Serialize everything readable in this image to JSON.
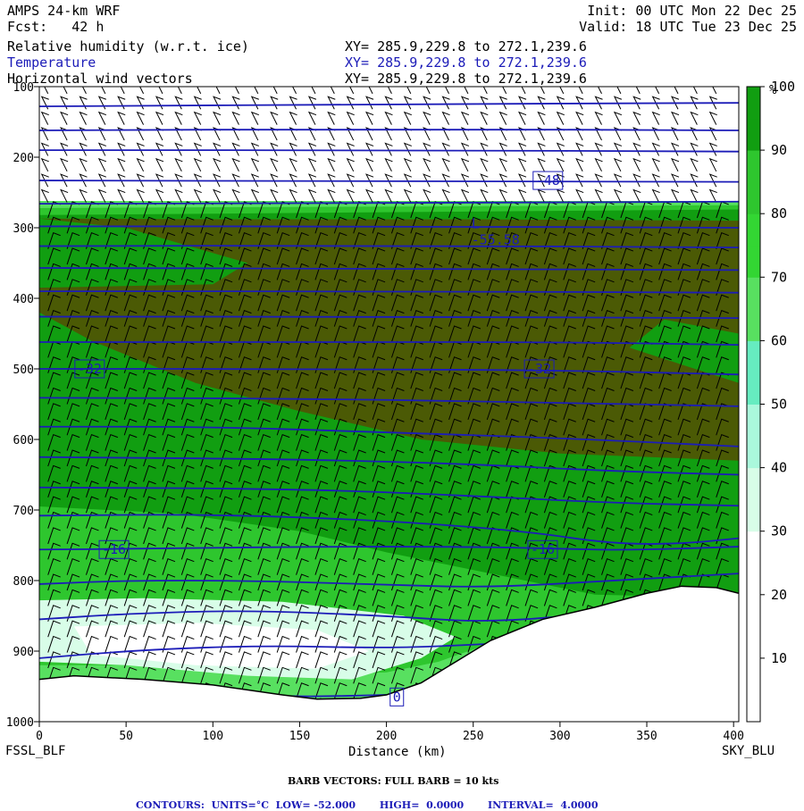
{
  "header": {
    "model": "AMPS 24-km WRF",
    "init": "Init: 00 UTC Mon 22 Dec 25",
    "fcst_label": "Fcst:",
    "fcst_value": "42 h",
    "valid": "Valid: 18 UTC Tue 23 Dec 25",
    "fields": [
      {
        "name": "Relative humidity (w.r.t. ice)",
        "xy": "XY= 285.9,229.8 to 272.1,239.6"
      },
      {
        "name": "Temperature",
        "xy": "XY= 285.9,229.8 to 272.1,239.6"
      },
      {
        "name": "Horizontal wind vectors",
        "xy": "XY= 285.9,229.8 to 272.1,239.6"
      }
    ]
  },
  "colors": {
    "contour": "#1c1cb8",
    "rh_bands": [
      "#ffffff",
      "#ffffff",
      "#ffffff",
      "#d8fde8",
      "#aaf8dc",
      "#66ecc0",
      "#58e060",
      "#33d633",
      "#2ec62e",
      "#119e11",
      "#4b5a05"
    ]
  },
  "chart_data": {
    "type": "cross-section",
    "xlabel": "Distance (km)",
    "x_ticks": [
      0,
      50,
      100,
      150,
      200,
      250,
      300,
      350,
      400
    ],
    "xlim": [
      0,
      403
    ],
    "y_ticks": [
      100,
      200,
      300,
      400,
      500,
      600,
      700,
      800,
      900,
      1000
    ],
    "ylim": [
      100,
      1000
    ],
    "left_endpoint": "FSSL_BLF",
    "right_endpoint": "SKY_BLU",
    "colorbar": {
      "unit": "%",
      "ticks": [
        10,
        20,
        30,
        40,
        50,
        60,
        70,
        80,
        90,
        100
      ],
      "bounds": [
        0,
        100
      ]
    },
    "terrain_surface": [
      [
        0,
        940
      ],
      [
        20,
        935
      ],
      [
        60,
        940
      ],
      [
        100,
        948
      ],
      [
        140,
        962
      ],
      [
        160,
        968
      ],
      [
        185,
        967
      ],
      [
        200,
        962
      ],
      [
        220,
        945
      ],
      [
        240,
        915
      ],
      [
        260,
        885
      ],
      [
        290,
        855
      ],
      [
        320,
        838
      ],
      [
        350,
        818
      ],
      [
        370,
        808
      ],
      [
        390,
        810
      ],
      [
        403,
        818
      ]
    ],
    "temperature_contours": [
      {
        "value": 0,
        "p": [
          [
            0,
            955
          ],
          [
            40,
            953
          ],
          [
            100,
            960
          ],
          [
            150,
            965
          ],
          [
            200,
            962
          ]
        ]
      },
      {
        "value": -4,
        "p": [
          [
            0,
            910
          ],
          [
            60,
            898
          ],
          [
            130,
            892
          ],
          [
            200,
            896
          ],
          [
            260,
            890
          ],
          [
            330,
            880
          ],
          [
            403,
            868
          ]
        ]
      },
      {
        "value": -8,
        "p": [
          [
            0,
            855
          ],
          [
            50,
            847
          ],
          [
            120,
            842
          ],
          [
            200,
            850
          ],
          [
            260,
            860
          ],
          [
            330,
            844
          ],
          [
            403,
            828
          ]
        ]
      },
      {
        "value": -12,
        "p": [
          [
            0,
            805
          ],
          [
            50,
            800
          ],
          [
            120,
            800
          ],
          [
            200,
            806
          ],
          [
            260,
            810
          ],
          [
            330,
            800
          ],
          [
            403,
            790
          ]
        ]
      },
      {
        "value": -16,
        "p": [
          [
            0,
            756
          ],
          [
            60,
            755
          ],
          [
            150,
            752
          ],
          [
            250,
            752
          ],
          [
            300,
            755
          ],
          [
            340,
            757
          ],
          [
            403,
            752
          ]
        ]
      },
      {
        "value": -20,
        "p": [
          [
            0,
            708
          ],
          [
            100,
            706
          ],
          [
            200,
            715
          ],
          [
            280,
            730
          ],
          [
            330,
            748
          ],
          [
            370,
            748
          ],
          [
            403,
            740
          ]
        ]
      },
      {
        "value": -24,
        "p": [
          [
            0,
            668
          ],
          [
            150,
            670
          ],
          [
            250,
            680
          ],
          [
            330,
            690
          ],
          [
            403,
            694
          ]
        ]
      },
      {
        "value": -28,
        "p": [
          [
            0,
            625
          ],
          [
            150,
            628
          ],
          [
            250,
            635
          ],
          [
            330,
            645
          ],
          [
            403,
            650
          ]
        ]
      },
      {
        "value": -32,
        "p": [
          [
            0,
            582
          ],
          [
            100,
            582
          ],
          [
            200,
            590
          ],
          [
            300,
            598
          ],
          [
            403,
            610
          ]
        ]
      },
      {
        "value": -36,
        "p": [
          [
            0,
            541
          ],
          [
            150,
            542
          ],
          [
            300,
            548
          ],
          [
            403,
            553
          ]
        ]
      },
      {
        "value": -40,
        "p": [
          [
            0,
            500
          ],
          [
            150,
            500
          ],
          [
            300,
            502
          ],
          [
            403,
            508
          ]
        ]
      },
      {
        "value": -44,
        "p": [
          [
            0,
            462
          ],
          [
            150,
            462
          ],
          [
            300,
            462
          ],
          [
            403,
            466
          ]
        ]
      },
      {
        "value": -48,
        "p": [
          [
            0,
            426
          ],
          [
            200,
            426
          ],
          [
            403,
            428
          ]
        ]
      },
      {
        "value": -52,
        "p": [
          [
            0,
            390
          ],
          [
            200,
            390
          ],
          [
            403,
            392
          ]
        ]
      },
      {
        "value": -56,
        "p": [
          [
            0,
            357
          ],
          [
            200,
            358
          ],
          [
            403,
            360
          ]
        ]
      },
      {
        "value": -52,
        "p": [
          [
            0,
            326
          ],
          [
            200,
            325
          ],
          [
            403,
            328
          ]
        ]
      },
      {
        "value": -48,
        "p": [
          [
            0,
            298
          ],
          [
            200,
            298
          ],
          [
            403,
            300
          ]
        ]
      },
      {
        "value": -48,
        "p": [
          [
            0,
            266
          ],
          [
            200,
            265
          ],
          [
            403,
            263
          ]
        ]
      },
      {
        "value": -48,
        "p": [
          [
            0,
            233
          ],
          [
            200,
            234
          ],
          [
            403,
            235
          ]
        ]
      },
      {
        "value": -48,
        "p": [
          [
            0,
            190
          ],
          [
            200,
            190
          ],
          [
            403,
            192
          ]
        ]
      },
      {
        "value": -48,
        "p": [
          [
            0,
            162
          ],
          [
            200,
            160
          ],
          [
            403,
            162
          ]
        ]
      },
      {
        "value": -44,
        "p": [
          [
            0,
            128
          ],
          [
            200,
            125
          ],
          [
            403,
            123
          ]
        ]
      }
    ],
    "contour_labels": [
      {
        "text": "-48",
        "x": 293,
        "p": 233
      },
      {
        "text": "-32",
        "x": 29,
        "p": 500
      },
      {
        "text": "-32",
        "x": 288,
        "p": 500
      },
      {
        "text": "-16",
        "x": 43,
        "p": 756
      },
      {
        "text": "-16",
        "x": 290,
        "p": 756
      },
      {
        "text": "0",
        "x": 206,
        "p": 965
      }
    ],
    "minimum_marker": {
      "symbol": "L",
      "value": "-55.58",
      "x": 250,
      "p": 313
    },
    "rh_bands": [
      {
        "min": 60,
        "p": [
          [
            0,
            262
          ],
          [
            403,
            262
          ],
          [
            403,
            1000
          ],
          [
            0,
            1000
          ]
        ]
      },
      {
        "min": 80,
        "p": [
          [
            0,
            272
          ],
          [
            403,
            268
          ],
          [
            403,
            835
          ],
          [
            330,
            840
          ],
          [
            270,
            880
          ],
          [
            230,
            915
          ],
          [
            200,
            930
          ],
          [
            150,
            935
          ],
          [
            80,
            920
          ],
          [
            0,
            920
          ]
        ]
      },
      {
        "min": 90,
        "p": [
          [
            0,
            282
          ],
          [
            403,
            274
          ],
          [
            403,
            825
          ],
          [
            320,
            820
          ],
          [
            260,
            790
          ],
          [
            200,
            760
          ],
          [
            150,
            730
          ],
          [
            80,
            705
          ],
          [
            0,
            695
          ]
        ]
      },
      {
        "min": 100,
        "p": [
          [
            0,
            287
          ],
          [
            120,
            288
          ],
          [
            250,
            288
          ],
          [
            403,
            290
          ],
          [
            403,
            450
          ],
          [
            360,
            430
          ],
          [
            340,
            470
          ],
          [
            403,
            520
          ],
          [
            403,
            630
          ],
          [
            300,
            620
          ],
          [
            220,
            600
          ],
          [
            150,
            560
          ],
          [
            90,
            520
          ],
          [
            30,
            460
          ],
          [
            0,
            420
          ],
          [
            0,
            385
          ],
          [
            100,
            380
          ],
          [
            120,
            350
          ],
          [
            50,
            300
          ]
        ]
      },
      {
        "min": 30,
        "p": [
          [
            0,
            828
          ],
          [
            60,
            825
          ],
          [
            140,
            830
          ],
          [
            210,
            850
          ],
          [
            240,
            880
          ],
          [
            220,
            910
          ],
          [
            180,
            940
          ],
          [
            120,
            935
          ],
          [
            50,
            920
          ],
          [
            0,
            915
          ]
        ]
      },
      {
        "min": 20,
        "p": [
          [
            20,
            865
          ],
          [
            90,
            860
          ],
          [
            160,
            870
          ],
          [
            190,
            900
          ],
          [
            160,
            925
          ],
          [
            90,
            920
          ],
          [
            30,
            905
          ]
        ]
      }
    ],
    "wind_barbs_note": "BARB VECTORS: FULL BARB = 10 kts",
    "contours_note": {
      "units_label": "UNITS=°C",
      "low_label": "LOW=",
      "low_value": "-52.000",
      "high_label": "HIGH=",
      "high_value": "0.0000",
      "interval_label": "INTERVAL=",
      "interval_value": "4.0000",
      "prefix": "CONTOURS:"
    }
  }
}
